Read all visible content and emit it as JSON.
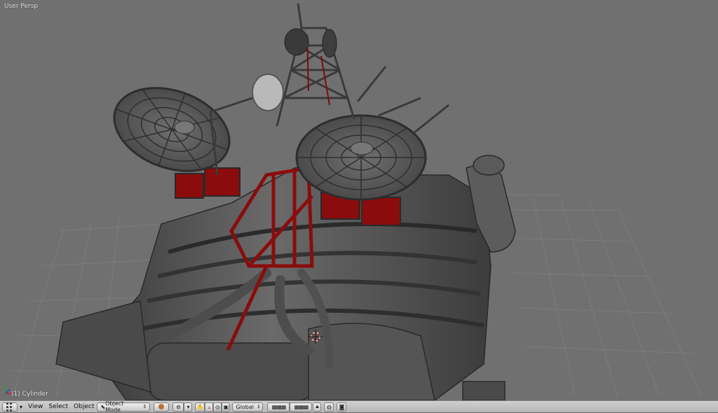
{
  "viewport": {
    "title": "User Persp",
    "object_label": "(1) Cylinder"
  },
  "header": {
    "editor_icon": "view3d-grid-icon",
    "menus": [
      "View",
      "Select",
      "Object"
    ],
    "mode": "Object Mode",
    "orientation": "Global"
  },
  "colors": {
    "viewport_bg": "#707070",
    "header_bg": "#c4c4c4",
    "model_body": "#5a5a5a",
    "model_accent_red": "#8a0c0c",
    "grid_lines": "#8c7a7a"
  }
}
